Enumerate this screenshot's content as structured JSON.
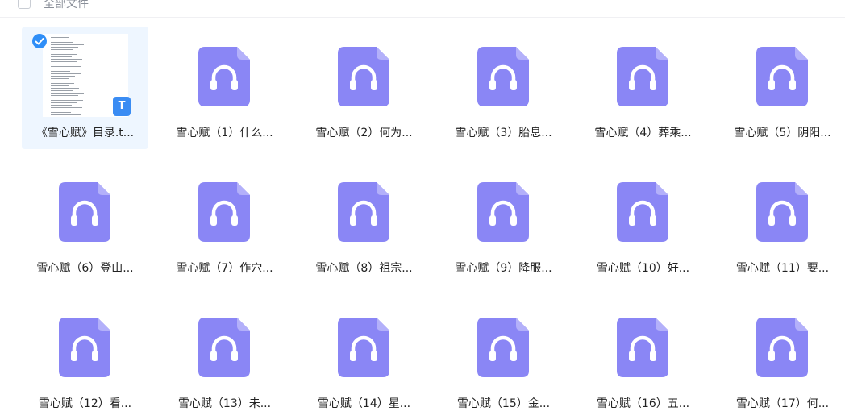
{
  "header": {
    "select_all_label": "全部文件"
  },
  "colors": {
    "audio_icon": "#8a86f5",
    "selected_bg": "#eef6ff",
    "check_blue": "#2f8ef7"
  },
  "files": [
    {
      "name": "《雪心赋》目录.t...",
      "type": "doc",
      "icon": "txt-thumbnail",
      "selected": true
    },
    {
      "name": "雪心赋（1）什么...",
      "type": "audio",
      "icon": "headphones-icon"
    },
    {
      "name": "雪心赋（2）何为...",
      "type": "audio",
      "icon": "headphones-icon"
    },
    {
      "name": "雪心赋（3）胎息...",
      "type": "audio",
      "icon": "headphones-icon"
    },
    {
      "name": "雪心赋（4）葬乘...",
      "type": "audio",
      "icon": "headphones-icon"
    },
    {
      "name": "雪心赋（5）阴阳...",
      "type": "audio",
      "icon": "headphones-icon"
    },
    {
      "name": "雪心赋（6）登山...",
      "type": "audio",
      "icon": "headphones-icon"
    },
    {
      "name": "雪心赋（7）作穴...",
      "type": "audio",
      "icon": "headphones-icon"
    },
    {
      "name": "雪心赋（8）祖宗...",
      "type": "audio",
      "icon": "headphones-icon"
    },
    {
      "name": "雪心赋（9）降服...",
      "type": "audio",
      "icon": "headphones-icon"
    },
    {
      "name": "雪心赋（10）好...",
      "type": "audio",
      "icon": "headphones-icon"
    },
    {
      "name": "雪心赋（11）要...",
      "type": "audio",
      "icon": "headphones-icon"
    },
    {
      "name": "雪心赋（12）看...",
      "type": "audio",
      "icon": "headphones-icon"
    },
    {
      "name": "雪心赋（13）未...",
      "type": "audio",
      "icon": "headphones-icon"
    },
    {
      "name": "雪心赋（14）星...",
      "type": "audio",
      "icon": "headphones-icon"
    },
    {
      "name": "雪心赋（15）金...",
      "type": "audio",
      "icon": "headphones-icon"
    },
    {
      "name": "雪心赋（16）五...",
      "type": "audio",
      "icon": "headphones-icon"
    },
    {
      "name": "雪心赋（17）何...",
      "type": "audio",
      "icon": "headphones-icon"
    }
  ],
  "txt_badge": "T"
}
